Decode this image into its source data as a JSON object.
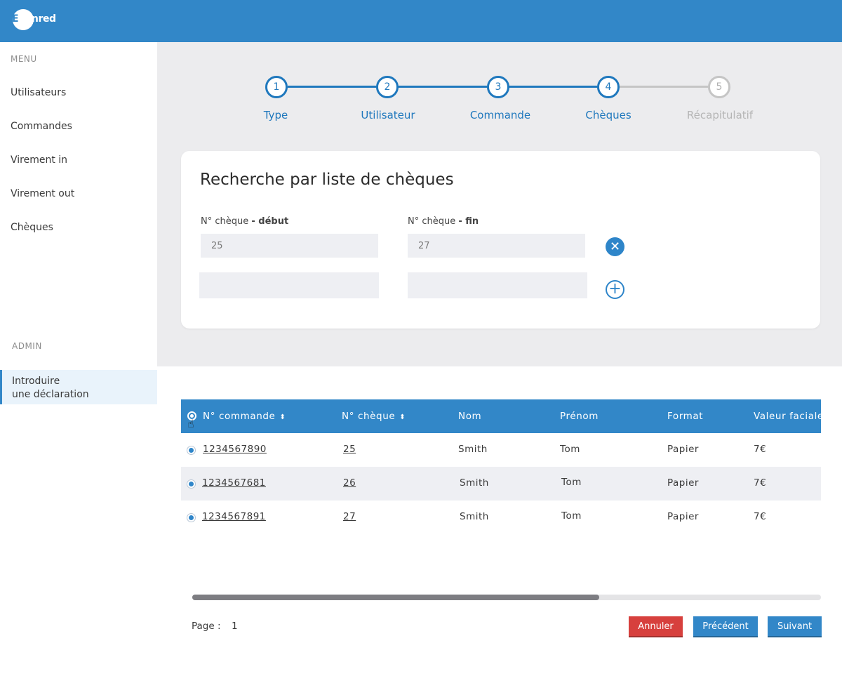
{
  "brand": {
    "logo_text_first": "E",
    "logo_text_rest": "denred",
    "primary_color": "#3287c8",
    "danger_color": "#d7403d"
  },
  "sidebar": {
    "menu_heading": "MENU",
    "items": [
      {
        "label": "Utilisateurs"
      },
      {
        "label": "Commandes"
      },
      {
        "label": "Virement in"
      },
      {
        "label": "Virement out"
      },
      {
        "label": "Chèques"
      }
    ],
    "admin_heading": "ADMIN",
    "admin_item": {
      "line1": "Introduire",
      "line2": "une déclaration"
    }
  },
  "stepper": {
    "steps": [
      {
        "number": "1",
        "label": "Type",
        "state": "done"
      },
      {
        "number": "2",
        "label": "Utilisateur",
        "state": "done"
      },
      {
        "number": "3",
        "label": "Commande",
        "state": "done"
      },
      {
        "number": "4",
        "label": "Chèques",
        "state": "current"
      },
      {
        "number": "5",
        "label": "Récapitulatif",
        "state": "pending"
      }
    ]
  },
  "search": {
    "title": "Recherche par liste de chèques",
    "start_label_prefix": "N° chèque",
    "start_label_suffix": "- début",
    "end_label_prefix": "N° chèque",
    "end_label_suffix": "- fin",
    "rows": [
      {
        "start": "25",
        "end": "27"
      },
      {
        "start": "",
        "end": ""
      }
    ],
    "remove_icon": "close-icon",
    "add_icon": "plus-circle-icon"
  },
  "table": {
    "columns": [
      "N° commande",
      "N° chèque",
      "Nom",
      "Prénom",
      "Format",
      "Valeur faciale"
    ],
    "rows": [
      {
        "commande": "1234567890",
        "cheque": "25",
        "nom": "Smith",
        "prenom": "Tom",
        "format": "Papier",
        "valeur": "7€"
      },
      {
        "commande": "1234567681",
        "cheque": "26",
        "nom": "Smith",
        "prenom": "Tom",
        "format": "Papier",
        "valeur": "7€"
      },
      {
        "commande": "1234567891",
        "cheque": "27",
        "nom": "Smith",
        "prenom": "Tom",
        "format": "Papier",
        "valeur": "7€"
      }
    ],
    "horizontal_scroll_fraction": 0.65
  },
  "footer": {
    "page_label": "Page :",
    "page_number": "1",
    "cancel_label": "Annuler",
    "previous_label": "Précédent",
    "next_label": "Suivant"
  }
}
